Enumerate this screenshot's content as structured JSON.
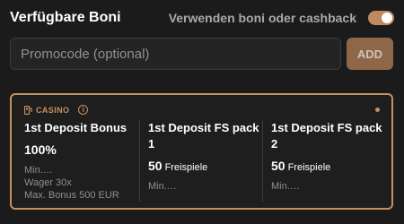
{
  "header": {
    "title": "Verfügbare Boni",
    "toggle_label": "Verwenden boni oder cashback",
    "toggle_on": true
  },
  "promo": {
    "placeholder": "Promocode (optional)",
    "value": "",
    "add_label": "ADD"
  },
  "card": {
    "tag": "CASINO",
    "tag_icon": "casino-icon",
    "accent_color": "#c5905f",
    "bonuses": [
      {
        "title": "1st Deposit Bonus",
        "value": "100%",
        "min": "Min.…",
        "wager": "Wager 30x",
        "max_bonus": "Max. Bonus 500 EUR"
      },
      {
        "title": "1st Deposit FS pack 1",
        "value": "50",
        "unit": "Freispiele",
        "min": "Min.…"
      },
      {
        "title": "1st Deposit FS pack 2",
        "value": "50",
        "unit": "Freispiele",
        "min": "Min.…"
      }
    ]
  }
}
